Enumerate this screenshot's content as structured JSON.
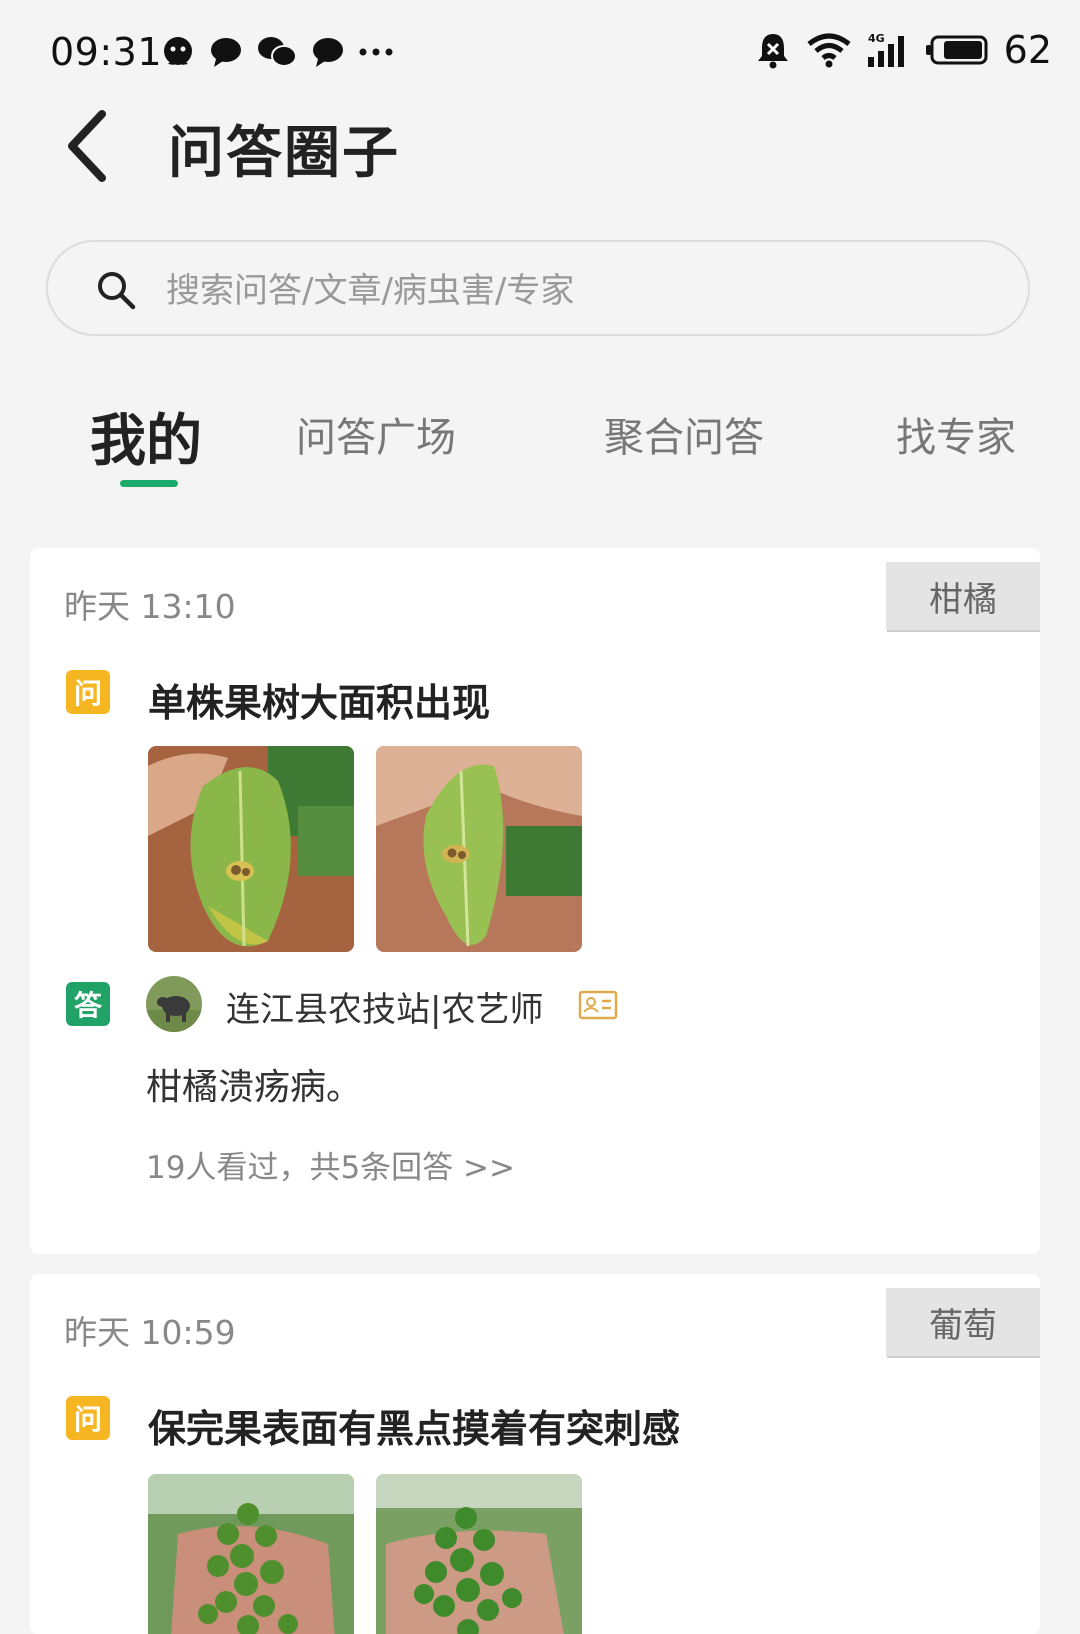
{
  "status_bar": {
    "time": "09:31",
    "battery": "62",
    "network": "4G"
  },
  "header": {
    "title": "问答圈子"
  },
  "search": {
    "placeholder": "搜索问答/文章/病虫害/专家"
  },
  "tabs": [
    {
      "label": "我的",
      "active": true
    },
    {
      "label": "问答广场",
      "active": false
    },
    {
      "label": "聚合问答",
      "active": false
    },
    {
      "label": "找专家",
      "active": false
    }
  ],
  "colors": {
    "accent": "#1aaa6a",
    "question_badge": "#f5b622",
    "answer_badge": "#21a367",
    "tag_bg": "#e4e4e4"
  },
  "cards": [
    {
      "time": "昨天 13:10",
      "tag": "柑橘",
      "question_badge": "问",
      "question": "单株果树大面积出现",
      "images": [
        "leaf-photo",
        "leaf-photo"
      ],
      "answer_badge": "答",
      "answerer": "连江县农技站|农艺师",
      "answer": "柑橘溃疡病。",
      "views": "19人看过，共5条回答 >>"
    },
    {
      "time": "昨天 10:59",
      "tag": "葡萄",
      "question_badge": "问",
      "question": "保完果表面有黑点摸着有突刺感",
      "images": [
        "grape-photo",
        "grape-photo"
      ]
    }
  ]
}
